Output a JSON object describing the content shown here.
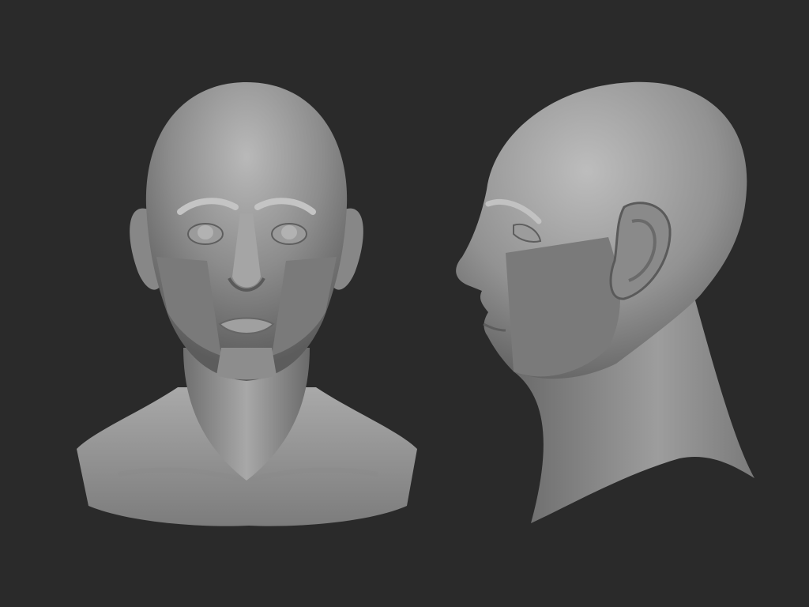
{
  "scene": {
    "background_color": "#2a2a2a",
    "material_color": "#8f8f8f",
    "views": [
      {
        "view": "front",
        "subject": "sculpted-head-bust"
      },
      {
        "view": "side-profile",
        "subject": "sculpted-head-bust"
      }
    ]
  }
}
